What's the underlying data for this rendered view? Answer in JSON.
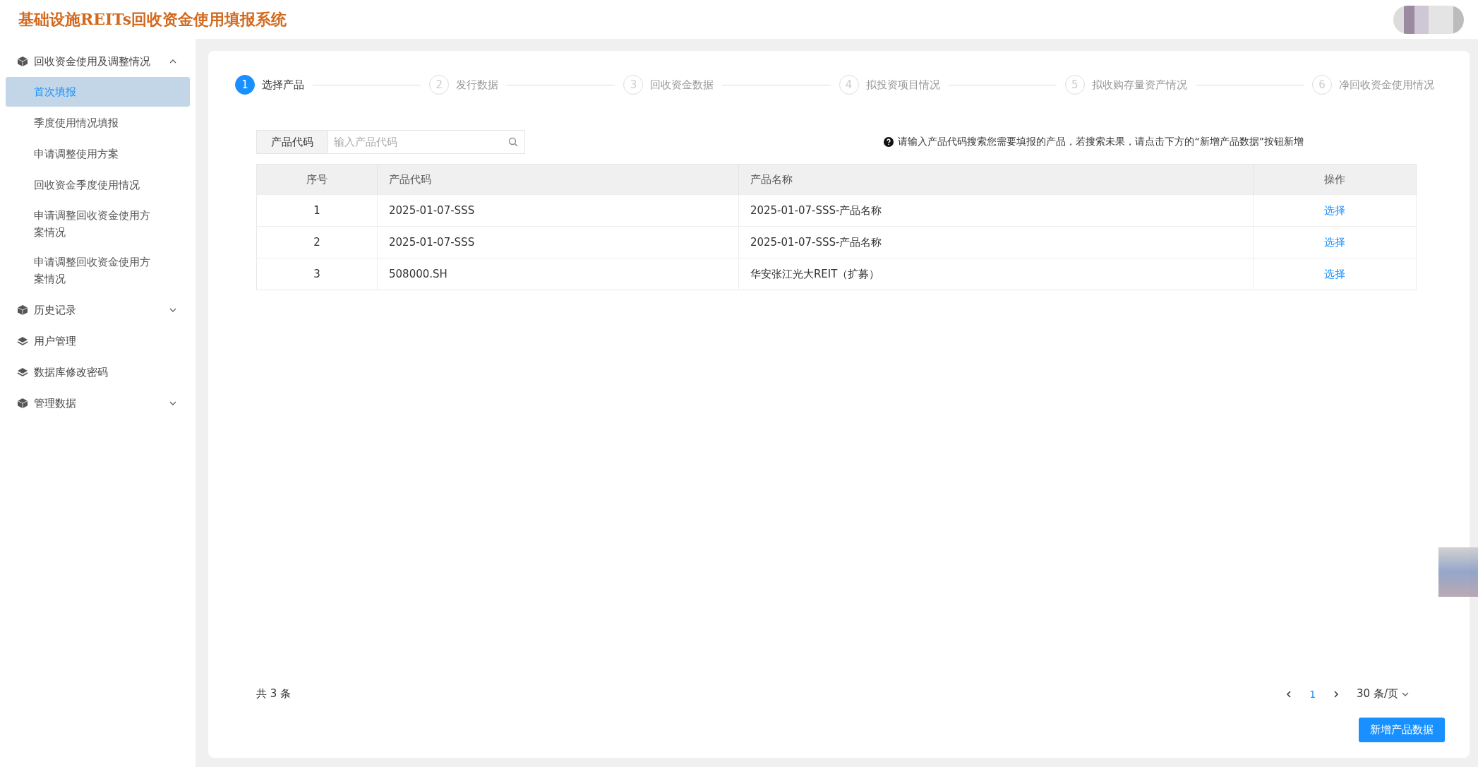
{
  "header": {
    "title": "基础设施REITs回收资金使用填报系统"
  },
  "sidebar": {
    "items": [
      {
        "kind": "group",
        "label": "回收资金使用及调整情况",
        "expanded": true,
        "children": [
          {
            "label": "首次填报",
            "selected": true
          },
          {
            "label": "季度使用情况填报",
            "selected": false
          },
          {
            "label": "申请调整使用方案",
            "selected": false
          },
          {
            "label": "回收资金季度使用情况",
            "selected": false
          },
          {
            "label": "申请调整回收资金使用方案情况",
            "selected": false
          },
          {
            "label": "申请调整回收资金使用方案情况",
            "selected": false
          }
        ]
      },
      {
        "kind": "group",
        "label": "历史记录",
        "expanded": false
      },
      {
        "kind": "link",
        "label": "用户管理"
      },
      {
        "kind": "link",
        "label": "数据库修改密码"
      },
      {
        "kind": "group",
        "label": "管理数据",
        "expanded": false
      }
    ]
  },
  "steps": [
    {
      "number": "1",
      "label": "选择产品",
      "selected": true
    },
    {
      "number": "2",
      "label": "发行数据",
      "selected": false
    },
    {
      "number": "3",
      "label": "回收资金数据",
      "selected": false
    },
    {
      "number": "4",
      "label": "拟投资项目情况",
      "selected": false
    },
    {
      "number": "5",
      "label": "拟收购存量资产情况",
      "selected": false
    },
    {
      "number": "6",
      "label": "净回收资金使用情况",
      "selected": false
    }
  ],
  "search": {
    "label": "产品代码",
    "placeholder": "输入产品代码"
  },
  "hint": "请输入产品代码搜索您需要填报的产品，若搜索未果，请点击下方的“新增产品数据”按钮新增",
  "table": {
    "columns": [
      "序号",
      "产品代码",
      "产品名称",
      "操作"
    ],
    "rows": [
      {
        "index": "1",
        "code": "2025-01-07-SSS",
        "name": "2025-01-07-SSS-产品名称",
        "action": "选择"
      },
      {
        "index": "2",
        "code": "2025-01-07-SSS",
        "name": "2025-01-07-SSS-产品名称",
        "action": "选择"
      },
      {
        "index": "3",
        "code": "508000.SH",
        "name": "华安张江光大REIT（扩募）",
        "action": "选择"
      }
    ]
  },
  "pagination": {
    "total": "共 3 条",
    "pages": [
      {
        "label": "1",
        "selected": true
      }
    ],
    "page_size": "30 条/页"
  },
  "add_button": "新增产品数据"
}
